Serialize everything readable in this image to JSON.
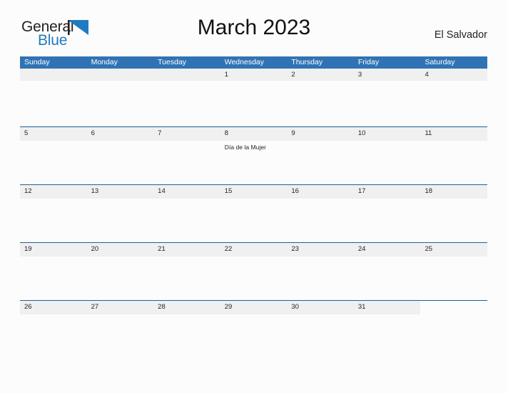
{
  "brand": {
    "name_part1": "General",
    "name_part2": "Blue",
    "flag_icon": "blue-triangle-flag-icon",
    "color_dark": "#231f20",
    "color_blue": "#1f7bc1"
  },
  "header": {
    "title": "March 2023",
    "country": "El Salvador"
  },
  "theme": {
    "header_blue": "#3073b5",
    "row_border_blue": "#1f6098",
    "band_gray": "#f0f0f0",
    "page_background": "#fcfcfc"
  },
  "calendar": {
    "month": "March",
    "year": "2023",
    "weekdays": [
      "Sunday",
      "Monday",
      "Tuesday",
      "Wednesday",
      "Thursday",
      "Friday",
      "Saturday"
    ],
    "weeks": [
      {
        "bordered": false,
        "days": [
          {
            "num": "",
            "event": ""
          },
          {
            "num": "",
            "event": ""
          },
          {
            "num": "",
            "event": ""
          },
          {
            "num": "1",
            "event": ""
          },
          {
            "num": "2",
            "event": ""
          },
          {
            "num": "3",
            "event": ""
          },
          {
            "num": "4",
            "event": ""
          }
        ]
      },
      {
        "bordered": true,
        "days": [
          {
            "num": "5",
            "event": ""
          },
          {
            "num": "6",
            "event": ""
          },
          {
            "num": "7",
            "event": ""
          },
          {
            "num": "8",
            "event": "Día de la Mujer"
          },
          {
            "num": "9",
            "event": ""
          },
          {
            "num": "10",
            "event": ""
          },
          {
            "num": "11",
            "event": ""
          }
        ]
      },
      {
        "bordered": true,
        "days": [
          {
            "num": "12",
            "event": ""
          },
          {
            "num": "13",
            "event": ""
          },
          {
            "num": "14",
            "event": ""
          },
          {
            "num": "15",
            "event": ""
          },
          {
            "num": "16",
            "event": ""
          },
          {
            "num": "17",
            "event": ""
          },
          {
            "num": "18",
            "event": ""
          }
        ]
      },
      {
        "bordered": true,
        "days": [
          {
            "num": "19",
            "event": ""
          },
          {
            "num": "20",
            "event": ""
          },
          {
            "num": "21",
            "event": ""
          },
          {
            "num": "22",
            "event": ""
          },
          {
            "num": "23",
            "event": ""
          },
          {
            "num": "24",
            "event": ""
          },
          {
            "num": "25",
            "event": ""
          }
        ]
      },
      {
        "bordered": true,
        "days": [
          {
            "num": "26",
            "event": ""
          },
          {
            "num": "27",
            "event": ""
          },
          {
            "num": "28",
            "event": ""
          },
          {
            "num": "29",
            "event": ""
          },
          {
            "num": "30",
            "event": ""
          },
          {
            "num": "31",
            "event": ""
          },
          {
            "num": "",
            "event": "",
            "blank": true
          }
        ]
      }
    ]
  }
}
